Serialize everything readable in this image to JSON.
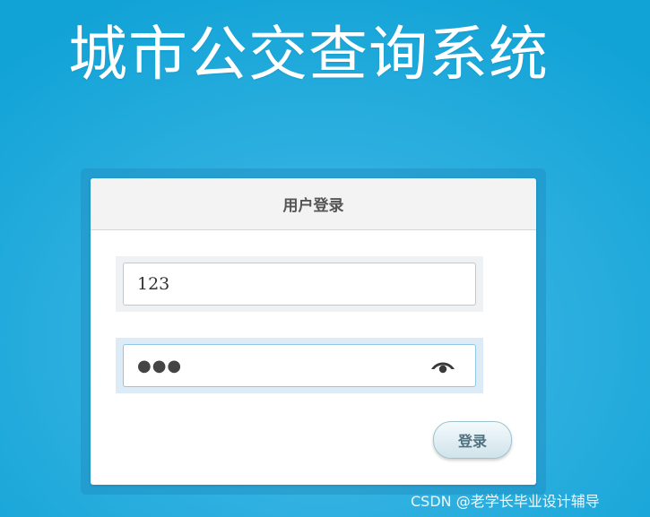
{
  "app": {
    "title": "城市公交查询系统"
  },
  "login": {
    "header_title": "用户登录",
    "username_value": "123",
    "password_mask": "●●●",
    "password_toggle_icon": "eye-icon",
    "submit_label": "登录"
  },
  "watermark": {
    "text": "CSDN @老学长毕业设计辅导"
  },
  "colors": {
    "background": "#12a3d6",
    "button_text": "#4f7180"
  }
}
